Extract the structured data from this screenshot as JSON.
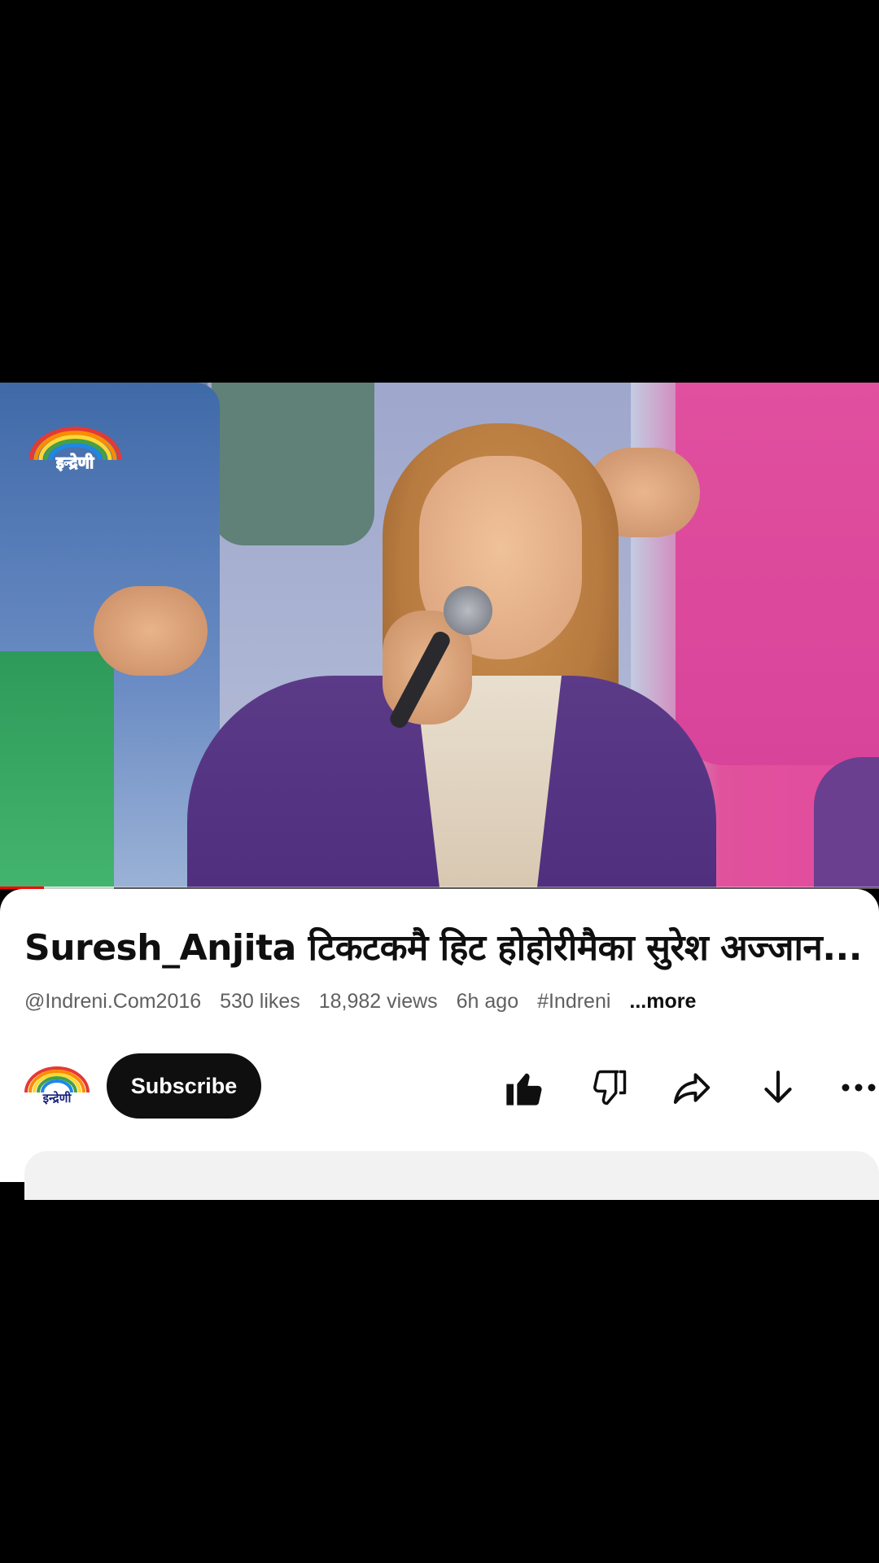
{
  "video": {
    "watermark": "इन्द्रेणी",
    "progress_percent": 5,
    "buffered_percent": 13,
    "colors": {
      "progress": "#ff0000"
    }
  },
  "info": {
    "title": "Suresh_Anjita टिकटकमै हिट होहोरीमैका सुरेश अज्जान...",
    "channel_handle": "@Indreni.Com2016",
    "likes": "530 likes",
    "views": "18,982 views",
    "age": "6h ago",
    "hashtag": "#Indreni",
    "more_label": "...more"
  },
  "actions": {
    "subscribe_label": "Subscribe",
    "icons": [
      "thumbs-up-icon",
      "thumbs-down-icon",
      "share-icon",
      "download-icon",
      "more-icon"
    ]
  },
  "channel": {
    "logo_text": "इन्द्रेणी"
  }
}
